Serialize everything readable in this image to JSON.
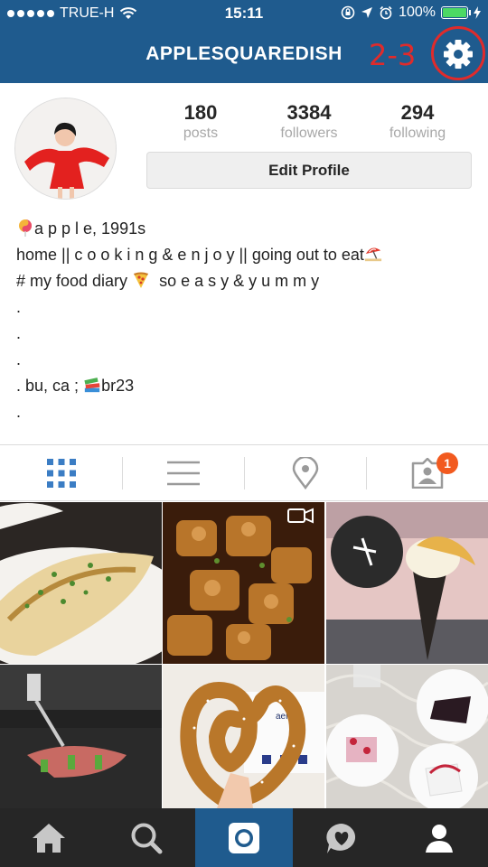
{
  "status_bar": {
    "carrier": "TRUE-H",
    "time": "15:11",
    "battery": "100%"
  },
  "header": {
    "username": "APPLESQUAREDISH",
    "annotation": "2-3",
    "settings_icon": "gear-icon"
  },
  "profile": {
    "stats": [
      {
        "value": "180",
        "label": "posts"
      },
      {
        "value": "3384",
        "label": "followers"
      },
      {
        "value": "294",
        "label": "following"
      }
    ],
    "edit_button": "Edit Profile"
  },
  "bio": {
    "lines": [
      "a p p l e, 1991s",
      "home || c o o k i n g & e n j o y || going out to eat",
      "# my food diary",
      "so e a s y & y u m m y",
      ".",
      ".",
      ".",
      ". bu, ca ;",
      "br23",
      "."
    ]
  },
  "tabs": {
    "items": [
      "grid-icon",
      "list-icon",
      "location-pin-icon",
      "tagged-photos-icon"
    ],
    "tagged_badge": "1"
  },
  "bottom_nav": {
    "items": [
      "home-icon",
      "search-icon",
      "camera-icon",
      "activity-heart-icon",
      "profile-icon"
    ],
    "active": "camera-icon"
  },
  "colors": {
    "header_bg": "#1f5b8e",
    "annotation": "#e02b2b",
    "badge": "#f25a1f",
    "nav_bg": "#262626",
    "active_tab": "#3b7dc4"
  }
}
